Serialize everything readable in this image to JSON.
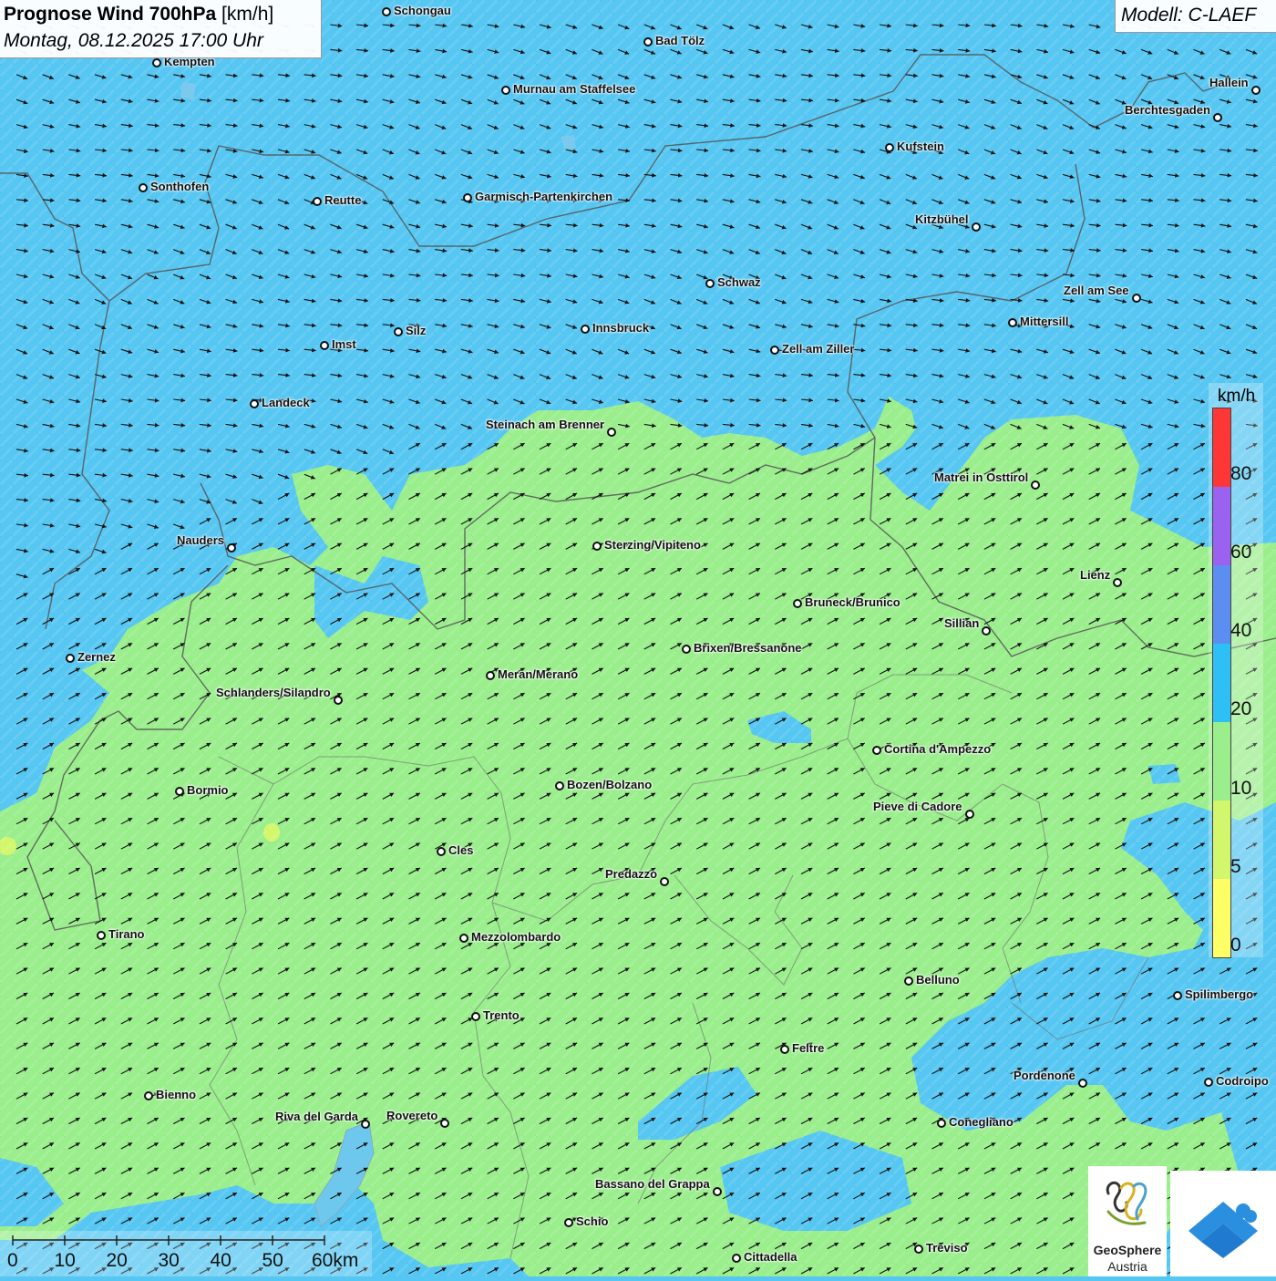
{
  "header": {
    "title_bold": "Prognose Wind 700hPa",
    "title_unit": " [km/h]",
    "datetime": "Montag, 08.12.2025 17:00 Uhr",
    "model": "Modell: C-LAEF"
  },
  "legend": {
    "unit": "km/h",
    "labels": [
      "0",
      "5",
      "10",
      "20",
      "40",
      "60",
      "80"
    ],
    "colors": [
      "#ffff66",
      "#d2f66c",
      "#9aee8c",
      "#2ec0f4",
      "#5b8ef0",
      "#9a62ee",
      "#ff3636"
    ]
  },
  "scale_bar": {
    "labels": [
      "0",
      "10",
      "20",
      "30",
      "40",
      "50",
      "60km"
    ]
  },
  "branding": {
    "name": "GeoSphere",
    "country": "Austria"
  },
  "wind_field": {
    "direction": "west-southwest to east-northeast",
    "bands": [
      "10–20 km/h south of the main Alpine ridge",
      "20–40 km/h north of the main Alpine ridge"
    ]
  },
  "cities": [
    {
      "name": "Schongau"
    },
    {
      "name": "Bad Tölz"
    },
    {
      "name": "Kempten"
    },
    {
      "name": "Murnau am Staffelsee"
    },
    {
      "name": "Hallein"
    },
    {
      "name": "Berchtesgaden"
    },
    {
      "name": "Kufstein"
    },
    {
      "name": "Sonthofen"
    },
    {
      "name": "Reutte"
    },
    {
      "name": "Garmisch-Partenkirchen"
    },
    {
      "name": "Kitzbühel"
    },
    {
      "name": "Schwaz"
    },
    {
      "name": "Zell am See"
    },
    {
      "name": "Mittersill"
    },
    {
      "name": "Innsbruck"
    },
    {
      "name": "Silz"
    },
    {
      "name": "Imst"
    },
    {
      "name": "Zell am Ziller"
    },
    {
      "name": "Landeck"
    },
    {
      "name": "Steinach am Brenner"
    },
    {
      "name": "Matrei in Osttirol"
    },
    {
      "name": "Nauders"
    },
    {
      "name": "Sterzing/Vipiteno"
    },
    {
      "name": "Lienz"
    },
    {
      "name": "Bruneck/Brunico"
    },
    {
      "name": "Sillian"
    },
    {
      "name": "Zernez"
    },
    {
      "name": "Brixen/Bressanone"
    },
    {
      "name": "Meran/Merano"
    },
    {
      "name": "Schlanders/Silandro"
    },
    {
      "name": "Cortina d'Ampezzo"
    },
    {
      "name": "Bozen/Bolzano"
    },
    {
      "name": "Bormio"
    },
    {
      "name": "Pieve di Cadore"
    },
    {
      "name": "Cles"
    },
    {
      "name": "Predazzo"
    },
    {
      "name": "Tirano"
    },
    {
      "name": "Mezzolombardo"
    },
    {
      "name": "Belluno"
    },
    {
      "name": "Spilimbergo"
    },
    {
      "name": "Trento"
    },
    {
      "name": "Feltre"
    },
    {
      "name": "Pordenone"
    },
    {
      "name": "Codroipo"
    },
    {
      "name": "Bienno"
    },
    {
      "name": "Riva del Garda"
    },
    {
      "name": "Rovereto"
    },
    {
      "name": "Conegliano"
    },
    {
      "name": "Bassano del Grappa"
    },
    {
      "name": "Schio"
    },
    {
      "name": "Treviso"
    },
    {
      "name": "Cittadella"
    }
  ]
}
